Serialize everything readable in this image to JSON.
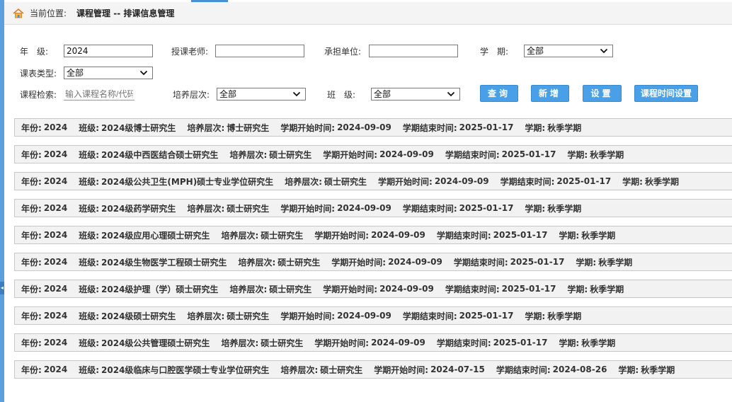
{
  "breadcrumb": {
    "label": "当前位置:",
    "path": "课程管理 -- 排课信息管理"
  },
  "filters": {
    "grade": {
      "label": "年　级:",
      "value": "2024"
    },
    "teacher": {
      "label": "授课老师:",
      "value": ""
    },
    "unit": {
      "label": "承担单位:",
      "value": ""
    },
    "semester": {
      "label": "学　期:",
      "value": "全部"
    },
    "schedule_type": {
      "label": "课表类型:",
      "value": "全部"
    },
    "course_search": {
      "label": "课程检索:",
      "placeholder": "输入课程名称/代码"
    },
    "level": {
      "label": "培养层次:",
      "value": "全部"
    },
    "class": {
      "label": "班　级:",
      "value": "全部"
    }
  },
  "buttons": {
    "query": "查询",
    "add": "新增",
    "settings": "设置",
    "time_settings": "课程时间设置"
  },
  "labels": {
    "year": "年份:",
    "class": "班级:",
    "level": "培养层次:",
    "start": "学期开始时间:",
    "end": "学期结束时间:",
    "term": "学期:"
  },
  "schedules": [
    {
      "year": "2024",
      "class": "2024级博士研究生",
      "level": "博士研究生",
      "start": "2024-09-09",
      "end": "2025-01-17",
      "term": "秋季学期"
    },
    {
      "year": "2024",
      "class": "2024级中西医结合硕士研究生",
      "level": "硕士研究生",
      "start": "2024-09-09",
      "end": "2025-01-17",
      "term": "秋季学期"
    },
    {
      "year": "2024",
      "class": "2024级公共卫生(MPH)硕士专业学位研究生",
      "level": "硕士研究生",
      "start": "2024-09-09",
      "end": "2025-01-17",
      "term": "秋季学期"
    },
    {
      "year": "2024",
      "class": "2024级药学研究生",
      "level": "硕士研究生",
      "start": "2024-09-09",
      "end": "2025-01-17",
      "term": "秋季学期"
    },
    {
      "year": "2024",
      "class": "2024级应用心理硕士研究生",
      "level": "硕士研究生",
      "start": "2024-09-09",
      "end": "2025-01-17",
      "term": "秋季学期"
    },
    {
      "year": "2024",
      "class": "2024级生物医学工程硕士研究生",
      "level": "硕士研究生",
      "start": "2024-09-09",
      "end": "2025-01-17",
      "term": "秋季学期"
    },
    {
      "year": "2024",
      "class": "2024级护理（学）硕士研究生",
      "level": "硕士研究生",
      "start": "2024-09-09",
      "end": "2025-01-17",
      "term": "秋季学期"
    },
    {
      "year": "2024",
      "class": "2024级硕士研究生",
      "level": "硕士研究生",
      "start": "2024-09-09",
      "end": "2025-01-17",
      "term": "秋季学期"
    },
    {
      "year": "2024",
      "class": "2024级公共管理硕士研究生",
      "level": "硕士研究生",
      "start": "2024-09-09",
      "end": "2025-01-17",
      "term": "秋季学期"
    },
    {
      "year": "2024",
      "class": "2024级临床与口腔医学硕士专业学位研究生",
      "level": "硕士研究生",
      "start": "2024-07-15",
      "end": "2024-08-26",
      "term": "秋季学期"
    }
  ]
}
